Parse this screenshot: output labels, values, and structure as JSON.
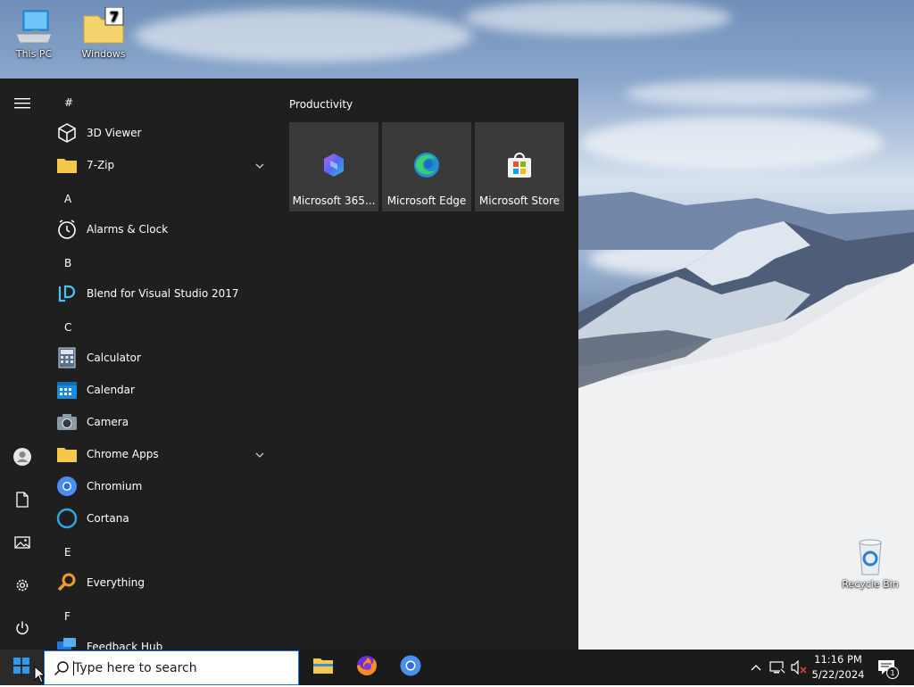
{
  "desktop": {
    "icons": [
      {
        "label": "This PC"
      },
      {
        "label": "Windows"
      },
      {
        "label": "Recycle Bin"
      }
    ]
  },
  "start_menu": {
    "rail": [
      "hamburger-icon",
      "user-icon",
      "documents-icon",
      "pictures-icon",
      "settings-icon",
      "power-icon"
    ],
    "sections": [
      {
        "letter": "#",
        "apps": [
          {
            "label": "3D Viewer"
          },
          {
            "label": "7-Zip",
            "expandable": true
          }
        ]
      },
      {
        "letter": "A",
        "apps": [
          {
            "label": "Alarms & Clock"
          }
        ]
      },
      {
        "letter": "B",
        "apps": [
          {
            "label": "Blend for Visual Studio 2017"
          }
        ]
      },
      {
        "letter": "C",
        "apps": [
          {
            "label": "Calculator"
          },
          {
            "label": "Calendar"
          },
          {
            "label": "Camera"
          },
          {
            "label": "Chrome Apps",
            "expandable": true
          },
          {
            "label": "Chromium"
          },
          {
            "label": "Cortana"
          }
        ]
      },
      {
        "letter": "E",
        "apps": [
          {
            "label": "Everything"
          }
        ]
      },
      {
        "letter": "F",
        "apps": [
          {
            "label": "Feedback Hub"
          }
        ]
      }
    ],
    "tile_group": {
      "title": "Productivity",
      "tiles": [
        {
          "label": "Microsoft 365..."
        },
        {
          "label": "Microsoft Edge"
        },
        {
          "label": "Microsoft Store"
        }
      ]
    }
  },
  "taskbar": {
    "search_placeholder": "Type here to search",
    "pinned": [
      "file-explorer-icon",
      "firefox-icon",
      "chromium-icon"
    ],
    "clock_time": "11:16 PM",
    "clock_date": "5/22/2024",
    "notification_count": "1"
  },
  "colors": {
    "start_bg": "#1f1f1f",
    "tile_bg": "#3a3a3a",
    "taskbar_bg": "#1b1b1b",
    "accent": "#1a73e8"
  }
}
